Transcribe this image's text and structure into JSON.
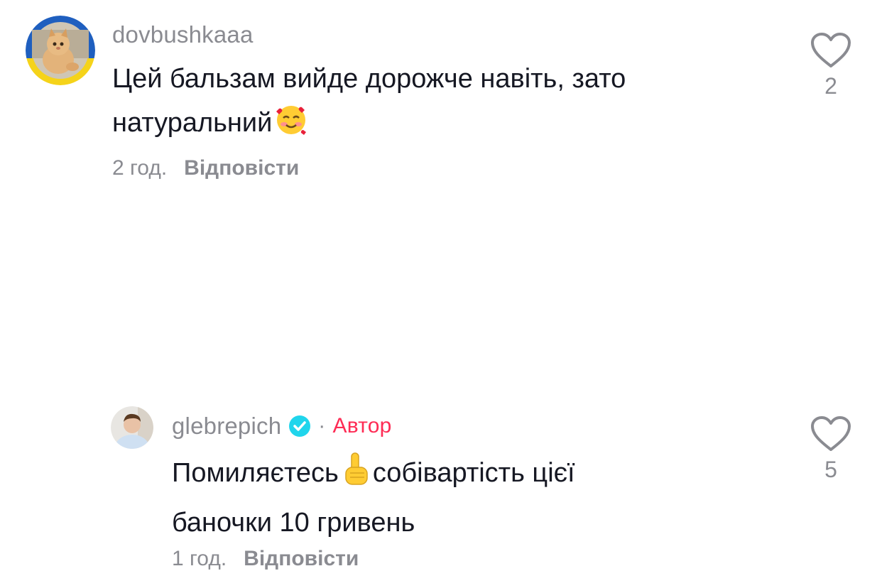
{
  "comments": [
    {
      "username": "dovbushkaaa",
      "text_line1": "Цей бальзам вийде дорожче навіть, зато",
      "text_line2": "натуральний",
      "emoji": "smiling-face-with-hearts",
      "time": "2 год.",
      "reply_label": "Відповісти",
      "like_count": "2"
    },
    {
      "username": "glebrepich",
      "separator": "·",
      "author_label": "Автор",
      "text_line1_a": "Помиляєтесь",
      "emoji": "index-pointing-up",
      "text_line1_b": "собівартість цієї",
      "text_line2": "баночки 10 гривень",
      "time": "1 год.",
      "reply_label": "Відповісти",
      "like_count": "5"
    }
  ],
  "colors": {
    "secondary_text": "#8a8b91",
    "primary_text": "#161823",
    "author_accent": "#fe2c55",
    "verified_blue": "#20d5ec"
  },
  "icons": [
    "heart-outline-icon",
    "verified-badge-icon"
  ]
}
